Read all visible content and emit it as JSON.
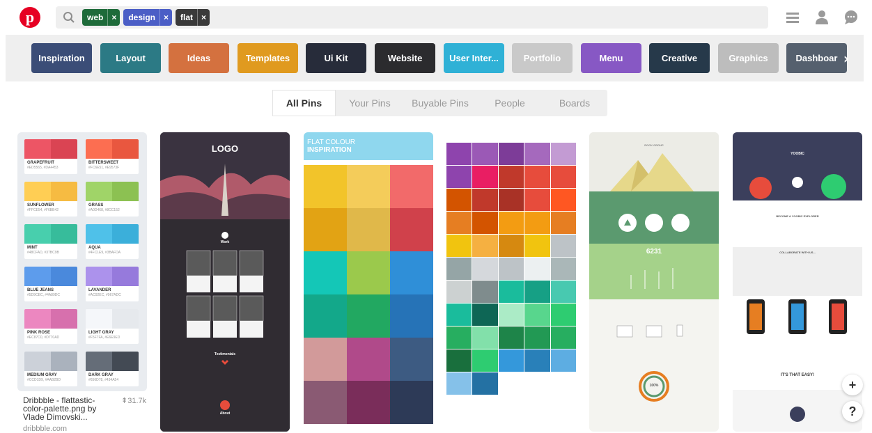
{
  "header": {
    "logo_text": "p",
    "tags": [
      {
        "label": "web",
        "color": "#1e6b3a"
      },
      {
        "label": "design",
        "color": "#4b5ec6"
      },
      {
        "label": "flat",
        "color": "#3a3a3a"
      }
    ],
    "tag_remove": "×",
    "icons": [
      "menu-icon",
      "profile-icon",
      "messages-icon"
    ]
  },
  "categories": {
    "items": [
      {
        "label": "Inspiration",
        "color": "#3b4d77"
      },
      {
        "label": "Layout",
        "color": "#2c7a85"
      },
      {
        "label": "Ideas",
        "color": "#d4713f"
      },
      {
        "label": "Templates",
        "color": "#e09a1f"
      },
      {
        "label": "Ui Kit",
        "color": "#272c3a"
      },
      {
        "label": "Website",
        "color": "#2b2b2e"
      },
      {
        "label": "User Inter...",
        "color": "#2fb1d6"
      },
      {
        "label": "Portfolio",
        "color": "#c9c9c9"
      },
      {
        "label": "Menu",
        "color": "#8758c4"
      },
      {
        "label": "Creative",
        "color": "#26394a"
      },
      {
        "label": "Graphics",
        "color": "#bdbdbd"
      },
      {
        "label": "Dashboar",
        "color": "#55606e"
      }
    ],
    "arrow": "›"
  },
  "tabs": {
    "items": [
      "All Pins",
      "Your Pins",
      "Buyable Pins",
      "People",
      "Boards"
    ],
    "active": "All Pins"
  },
  "pins": {
    "first": {
      "caption": "Dribbble - flattastic-color-palette.png by Vlade Dimovski...",
      "saves": "⇞31.7k",
      "domain": "dribbble.com"
    },
    "palette": [
      {
        "name": "GRAPEFRUIT",
        "hex": "#ED5565, #DA4453",
        "c1": "#ED5565",
        "c2": "#DA4453"
      },
      {
        "name": "BITTERSWEET",
        "hex": "#FC6E51, #E9573F",
        "c1": "#FC6E51",
        "c2": "#E9573F"
      },
      {
        "name": "SUNFLOWER",
        "hex": "#FFCE54, #F6BB42",
        "c1": "#FFCE54",
        "c2": "#F6BB42"
      },
      {
        "name": "GRASS",
        "hex": "#A0D468, #8CC152",
        "c1": "#A0D468",
        "c2": "#8CC152"
      },
      {
        "name": "MINT",
        "hex": "#48CFAD, #37BC9B",
        "c1": "#48CFAD",
        "c2": "#37BC9B"
      },
      {
        "name": "AQUA",
        "hex": "#4FC1E9, #3BAFDA",
        "c1": "#4FC1E9",
        "c2": "#3BAFDA"
      },
      {
        "name": "BLUE JEANS",
        "hex": "#5D9CEC, #4A89DC",
        "c1": "#5D9CEC",
        "c2": "#4A89DC"
      },
      {
        "name": "LAVANDER",
        "hex": "#AC92EC, #967ADC",
        "c1": "#AC92EC",
        "c2": "#967ADC"
      },
      {
        "name": "PINK ROSE",
        "hex": "#EC87C0, #D770AD",
        "c1": "#EC87C0",
        "c2": "#D770AD"
      },
      {
        "name": "LIGHT GRAY",
        "hex": "#F5F7FA, #E6E9ED",
        "c1": "#F5F7FA",
        "c2": "#E6E9ED"
      },
      {
        "name": "MEDIUM GRAY",
        "hex": "#CCD1D9, #AAB2BD",
        "c1": "#CCD1D9",
        "c2": "#AAB2BD"
      },
      {
        "name": "DARK GRAY",
        "hex": "#656D78, #434A54",
        "c1": "#656D78",
        "c2": "#434A54"
      }
    ],
    "second": {
      "logo": "LOGO",
      "section": "Work",
      "project_label": "PROJECT",
      "testimonials": "Testimonials",
      "about": "About"
    },
    "third": {
      "title_line1": "FLAT COLOUR",
      "title_line2": "INSPIRATION",
      "colors": [
        "#f2c42a",
        "#f4cc5a",
        "#f26a6a",
        "#e2a314",
        "#e0b84a",
        "#d0414b",
        "#14c7b7",
        "#9bc94c",
        "#2f8fd8",
        "#13a88a",
        "#22a861",
        "#2673b7",
        "#d29a9a",
        "#b04a8a",
        "#3d5b82",
        "#8a5a73",
        "#7a2d5a",
        "#2d3a57"
      ]
    },
    "fourth": {
      "colors": [
        "#8e44ad",
        "#9b59b6",
        "#7d3c98",
        "#a569bd",
        "#c39bd3",
        "#8e44ad",
        "#e91e63",
        "#c0392b",
        "#e74c3c",
        "#e74c3c",
        "#d35400",
        "#c0392b",
        "#a93226",
        "#e74c3c",
        "#ff5722",
        "#e67e22",
        "#d35400",
        "#f39c12",
        "#f39c12",
        "#e67e22",
        "#f1c40f",
        "#f5b041",
        "#d68910",
        "#f1c40f",
        "#bdc3c7",
        "#95a5a6",
        "#d5d8dc",
        "#bdc3c7",
        "#ecf0f1",
        "#aab7b8",
        "#ccd1d1",
        "#7f8c8d",
        "#1abc9c",
        "#16a085",
        "#48c9b0",
        "#1abc9c",
        "#0e6655",
        "#abebc6",
        "#58d68d",
        "#2ecc71",
        "#27ae60",
        "#82e0aa",
        "#1e8449",
        "#229954",
        "#27ae60",
        "#196f3d",
        "#2ecc71",
        "#3498db",
        "#2980b9",
        "#5dade2",
        "#85c1e9",
        "#2471a3"
      ]
    },
    "fifth": {
      "section1": "ROCK GROUP",
      "stat": "6231",
      "percent": "100%"
    },
    "sixth": {
      "brand": "YOOBIC",
      "headline": "BECOME A YOOBIC EXPLORER",
      "subhead": "COLLABORATE WITH US...",
      "cta": "IT'S THAT EASY!"
    }
  },
  "fab": {
    "add": "+",
    "help": "?"
  }
}
